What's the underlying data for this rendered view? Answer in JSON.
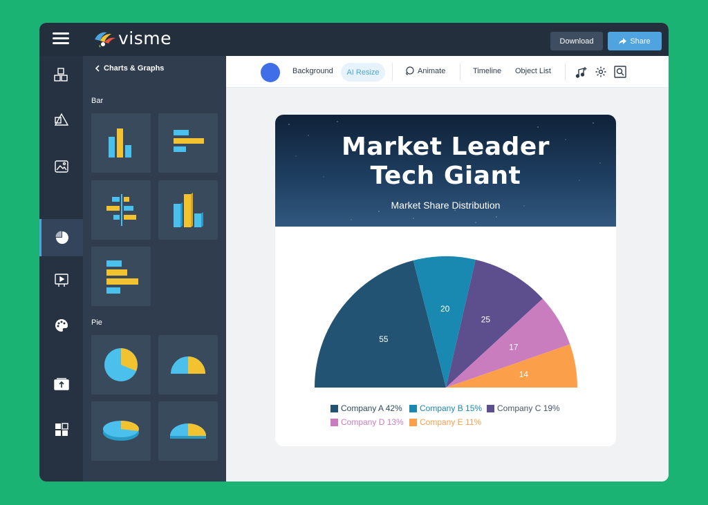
{
  "app": {
    "logo_text": "visme",
    "download_label": "Download",
    "share_label": "Share"
  },
  "rail": {
    "items": [
      "blocks-icon",
      "shapes-icon",
      "image-icon",
      "charts-icon",
      "media-icon",
      "palette-icon",
      "upload-icon",
      "apps-icon"
    ],
    "active": "charts-icon"
  },
  "panel": {
    "back_label": "Charts & Graphs",
    "sections": [
      "Bar",
      "Pie"
    ]
  },
  "toolbar": {
    "background_label": "Background",
    "ai_resize_label": "AI Resize",
    "animate_label": "Animate",
    "timeline_label": "Timeline",
    "object_list_label": "Object List",
    "swatch_color": "#3f6ee8"
  },
  "card": {
    "title_line1": "Market Leader",
    "title_line2": "Tech Giant",
    "subtitle": "Market Share Distribution"
  },
  "chart_data": {
    "type": "pie",
    "style": "semicircle",
    "categories": [
      "Company A",
      "Company B",
      "Company C",
      "Company D",
      "Company E"
    ],
    "values": [
      55,
      20,
      25,
      17,
      14
    ],
    "legend": [
      "Company A 42%",
      "Company B 15%",
      "Company C 19%",
      "Company D 13%",
      "Company E 11%"
    ],
    "colors": [
      "#225373",
      "#1989b2",
      "#5d4f8e",
      "#c97dbf",
      "#fb9f4a"
    ],
    "legend_placement": "bottom"
  }
}
